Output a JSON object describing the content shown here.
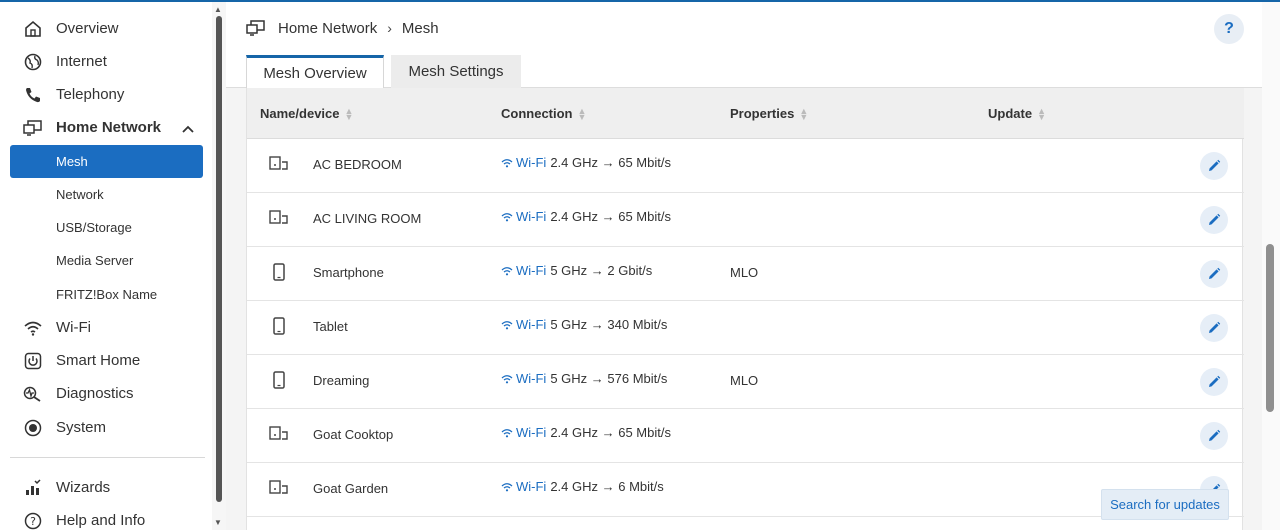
{
  "sidebar": {
    "items": [
      {
        "label": "Overview",
        "icon": "home-icon"
      },
      {
        "label": "Internet",
        "icon": "globe-icon"
      },
      {
        "label": "Telephony",
        "icon": "phone-icon"
      },
      {
        "label": "Home Network",
        "icon": "network-icon"
      },
      {
        "label": "Wi-Fi",
        "icon": "wifi-icon"
      },
      {
        "label": "Smart Home",
        "icon": "power-icon"
      },
      {
        "label": "Diagnostics",
        "icon": "diagnostics-icon"
      },
      {
        "label": "System",
        "icon": "system-icon"
      },
      {
        "label": "Wizards",
        "icon": "wizard-icon"
      },
      {
        "label": "Help and Info",
        "icon": "help-icon"
      }
    ],
    "sub_items": [
      {
        "label": "Mesh",
        "active": true
      },
      {
        "label": "Network"
      },
      {
        "label": "USB/Storage"
      },
      {
        "label": "Media Server"
      },
      {
        "label": "FRITZ!Box Name"
      }
    ]
  },
  "header": {
    "breadcrumb": [
      "Home Network",
      "Mesh"
    ],
    "help_label": "?",
    "tabs": [
      {
        "label": "Mesh Overview",
        "active": true
      },
      {
        "label": "Mesh Settings",
        "active": false
      }
    ]
  },
  "table": {
    "columns": [
      "Name/device",
      "Connection",
      "Properties",
      "Update"
    ],
    "rows": [
      {
        "name": "AC BEDROOM",
        "device": "iot-device",
        "wifi": "Wi-Fi",
        "speed": "2.4 GHz → 65 Mbit/s",
        "properties": ""
      },
      {
        "name": "AC LIVING ROOM",
        "device": "iot-device",
        "wifi": "Wi-Fi",
        "speed": "2.4 GHz → 65 Mbit/s",
        "properties": ""
      },
      {
        "name": "Smartphone",
        "device": "mobile",
        "wifi": "Wi-Fi",
        "speed": "5 GHz → 2 Gbit/s",
        "properties": "MLO"
      },
      {
        "name": "Tablet",
        "device": "mobile",
        "wifi": "Wi-Fi",
        "speed": "5 GHz → 340 Mbit/s",
        "properties": ""
      },
      {
        "name": "Dreaming",
        "device": "mobile",
        "wifi": "Wi-Fi",
        "speed": "5 GHz → 576 Mbit/s",
        "properties": "MLO"
      },
      {
        "name": "Goat Cooktop",
        "device": "iot-device",
        "wifi": "Wi-Fi",
        "speed": "2.4 GHz → 65 Mbit/s",
        "properties": ""
      },
      {
        "name": "Goat Garden",
        "device": "iot-device",
        "wifi": "Wi-Fi",
        "speed": "2.4 GHz → 6 Mbit/s",
        "properties": ""
      }
    ],
    "search_updates_label": "Search for updates"
  },
  "colors": {
    "accent": "#1b6dc1",
    "header_bg": "#efefef",
    "content_bg": "#f4f4f4"
  }
}
